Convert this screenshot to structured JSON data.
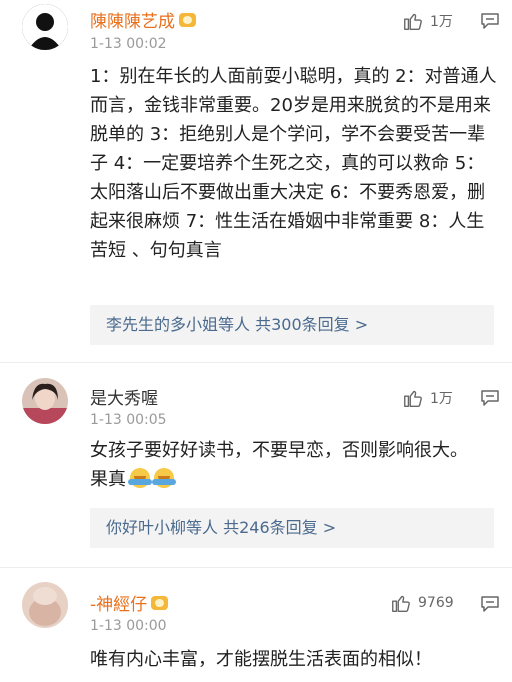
{
  "comments": [
    {
      "user": "陳陳陳艺成",
      "time": "1-13 00:02",
      "likes": "1万",
      "text": "1：别在年长的人面前耍小聪明，真的 2：对普通人而言，金钱非常重要。20岁是用来脱贫的不是用来脱单的 3：拒绝别人是个学问，学不会要受苦一辈子 4：一定要培养个生死之交，真的可以救命 5：太阳落山后不要做出重大决定 6：不要秀恩爱，删起来很麻烦 7：性生活在婚姻中非常重要 8：人生苦短 、句句真言",
      "replies": "李先生的多小姐等人  共300条回复 >"
    },
    {
      "user": "是大秀喔",
      "time": "1-13 00:05",
      "likes": "1万",
      "text": "女孩子要好好读书，不要早恋，否则影响很大。果真",
      "replies": "你好叶小柳等人  共246条回复 >"
    },
    {
      "user": "-神經仔",
      "time": "1-13 00:00",
      "likes": "9769",
      "text": "唯有内心丰富，才能摆脱生活表面的相似！"
    }
  ],
  "colors": {
    "username_accent": "#e8711f",
    "reply_link": "#4a6a8e",
    "timestamp": "#9a9a9a"
  },
  "icons": [
    "like-icon",
    "comment-icon",
    "vip-badge-icon",
    "emoji-icon"
  ]
}
